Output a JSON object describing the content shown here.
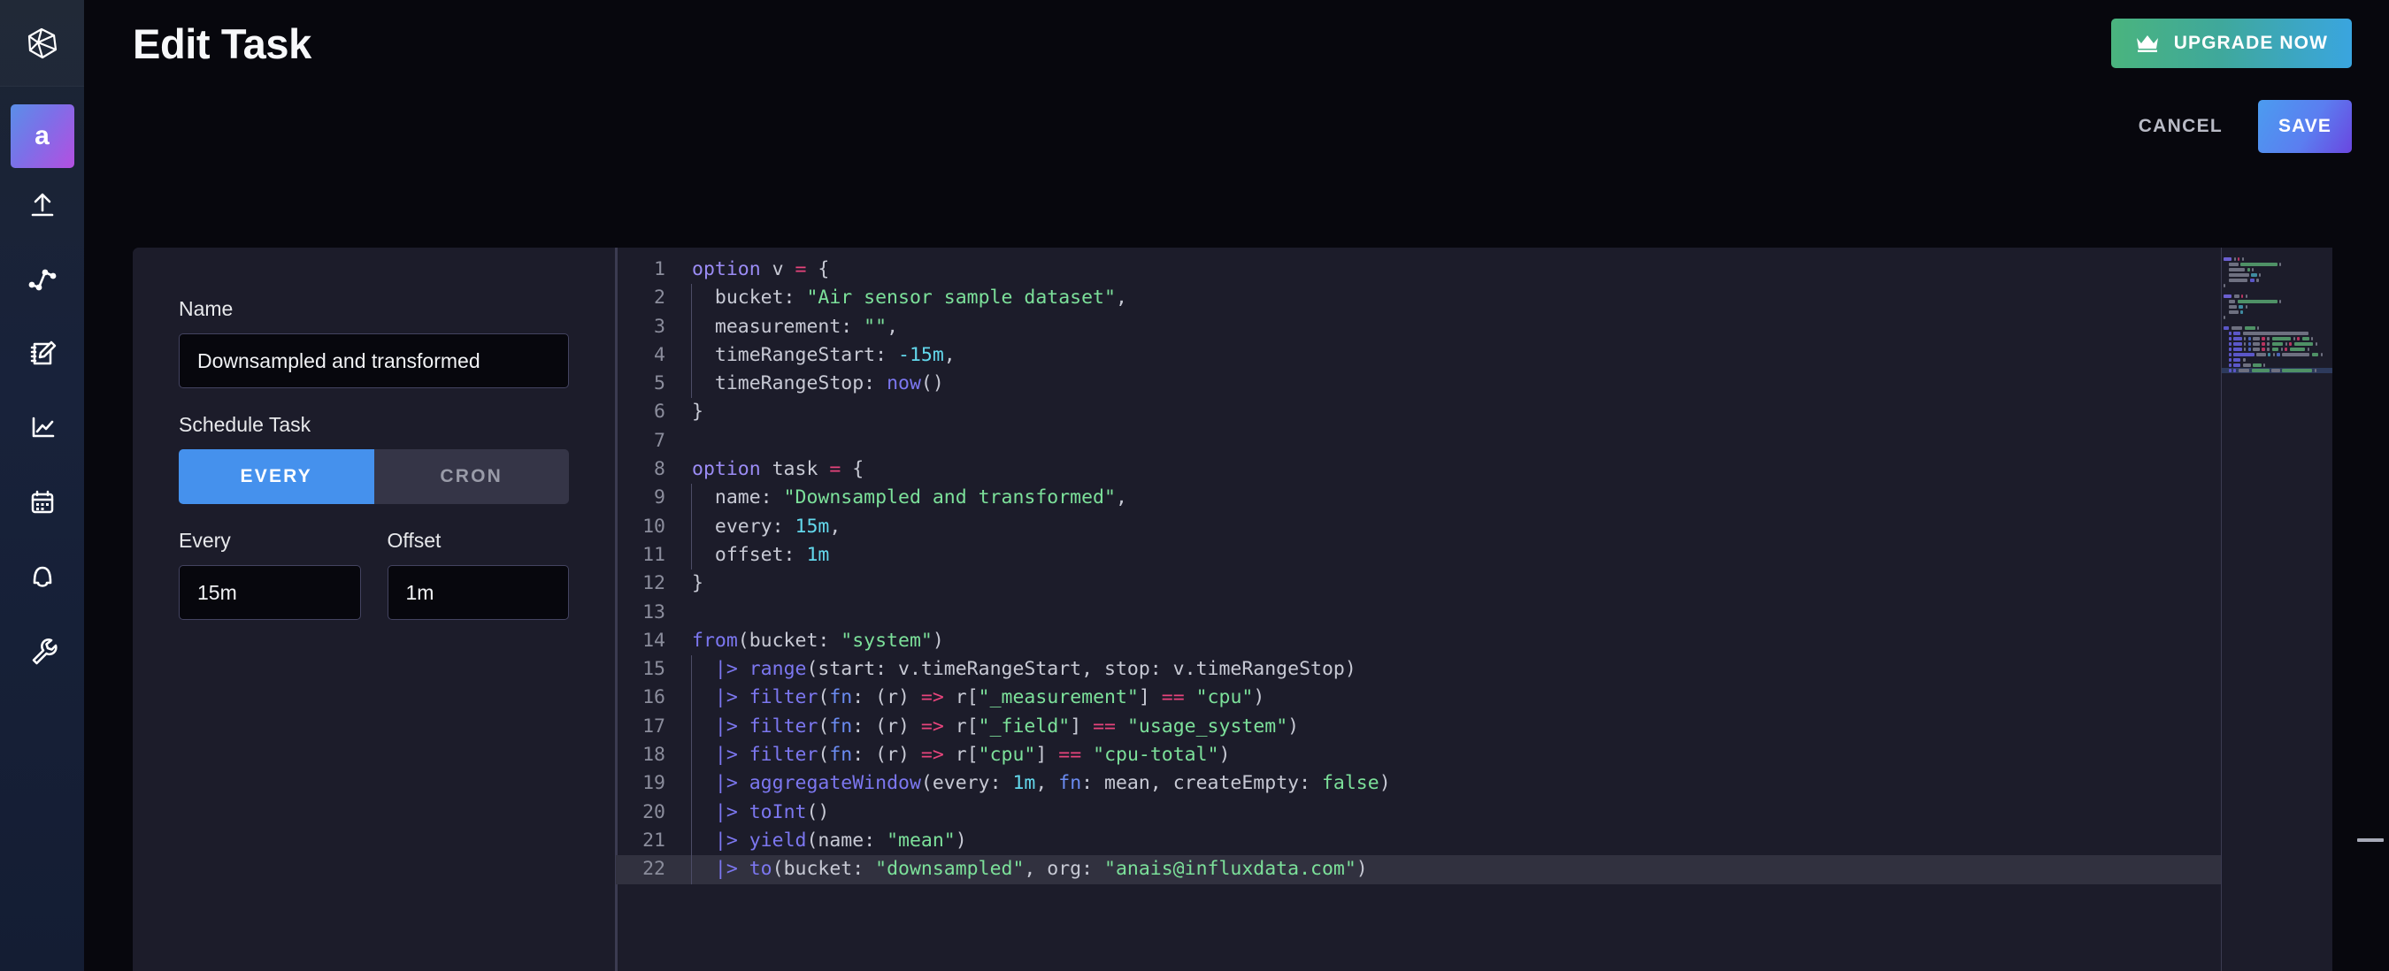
{
  "app": {
    "logo_icon": "influxdb-hexagon-logo",
    "background_color": "#07070d"
  },
  "sidebar": {
    "org_avatar": {
      "initial": "a",
      "gradient_from": "#5a8fe8",
      "gradient_to": "#b44fe0"
    },
    "items": [
      {
        "name": "load-data",
        "icon": "upload-arrow-icon"
      },
      {
        "name": "data-explorer",
        "icon": "line-graph-nodes-icon"
      },
      {
        "name": "notebooks",
        "icon": "notebook-pencil-icon"
      },
      {
        "name": "dashboards",
        "icon": "chart-axes-icon"
      },
      {
        "name": "tasks",
        "icon": "calendar-icon"
      },
      {
        "name": "alerts",
        "icon": "bell-icon"
      },
      {
        "name": "settings",
        "icon": "wrench-icon"
      }
    ]
  },
  "header": {
    "title": "Edit Task",
    "upgrade_label": "UPGRADE NOW",
    "upgrade_icon": "crown-icon",
    "upgrade_gradient_from": "#4ab47e",
    "upgrade_gradient_to": "#3aa5df"
  },
  "actions": {
    "cancel_label": "CANCEL",
    "save_label": "SAVE",
    "save_gradient_from": "#4b9cf0",
    "save_gradient_to": "#6a46e0"
  },
  "form": {
    "name_label": "Name",
    "name_value": "Downsampled and transformed",
    "schedule_label": "Schedule Task",
    "schedule_options": [
      "EVERY",
      "CRON"
    ],
    "schedule_selected": "EVERY",
    "active_toggle_color": "#4591ed",
    "inactive_toggle_color": "#353547",
    "every_label": "Every",
    "every_value": "15m",
    "offset_label": "Offset",
    "offset_value": "1m"
  },
  "editor": {
    "active_line": 22,
    "syntax_colors": {
      "keyword": "#9b8cf5",
      "operator": "#e8447c",
      "pipe": "#7c77f0",
      "function": "#7c77f0",
      "string": "#7ce09a",
      "number": "#63d8ec",
      "plain": "#c7c9d4"
    },
    "lines": [
      {
        "n": 1,
        "tokens": [
          {
            "t": "option ",
            "c": "kw"
          },
          {
            "t": "v ",
            "c": "plain"
          },
          {
            "t": "=",
            "c": "op"
          },
          {
            "t": " {",
            "c": "plain"
          }
        ]
      },
      {
        "n": 2,
        "indent": true,
        "tokens": [
          {
            "t": "  bucket: ",
            "c": "plain"
          },
          {
            "t": "\"Air sensor sample dataset\"",
            "c": "str"
          },
          {
            "t": ",",
            "c": "plain"
          }
        ]
      },
      {
        "n": 3,
        "indent": true,
        "tokens": [
          {
            "t": "  measurement: ",
            "c": "plain"
          },
          {
            "t": "\"\"",
            "c": "str"
          },
          {
            "t": ",",
            "c": "plain"
          }
        ]
      },
      {
        "n": 4,
        "indent": true,
        "tokens": [
          {
            "t": "  timeRangeStart: ",
            "c": "plain"
          },
          {
            "t": "-15m",
            "c": "num"
          },
          {
            "t": ",",
            "c": "plain"
          }
        ]
      },
      {
        "n": 5,
        "indent": true,
        "tokens": [
          {
            "t": "  timeRangeStop: ",
            "c": "plain"
          },
          {
            "t": "now",
            "c": "fn"
          },
          {
            "t": "()",
            "c": "plain"
          }
        ]
      },
      {
        "n": 6,
        "tokens": [
          {
            "t": "}",
            "c": "plain"
          }
        ]
      },
      {
        "n": 7,
        "tokens": []
      },
      {
        "n": 8,
        "tokens": [
          {
            "t": "option ",
            "c": "kw"
          },
          {
            "t": "task ",
            "c": "plain"
          },
          {
            "t": "=",
            "c": "op"
          },
          {
            "t": " {",
            "c": "plain"
          }
        ]
      },
      {
        "n": 9,
        "indent": true,
        "tokens": [
          {
            "t": "  name: ",
            "c": "plain"
          },
          {
            "t": "\"Downsampled and transformed\"",
            "c": "str"
          },
          {
            "t": ",",
            "c": "plain"
          }
        ]
      },
      {
        "n": 10,
        "indent": true,
        "tokens": [
          {
            "t": "  every: ",
            "c": "plain"
          },
          {
            "t": "15m",
            "c": "num"
          },
          {
            "t": ",",
            "c": "plain"
          }
        ]
      },
      {
        "n": 11,
        "indent": true,
        "tokens": [
          {
            "t": "  offset: ",
            "c": "plain"
          },
          {
            "t": "1m",
            "c": "num"
          }
        ]
      },
      {
        "n": 12,
        "tokens": [
          {
            "t": "}",
            "c": "plain"
          }
        ]
      },
      {
        "n": 13,
        "tokens": []
      },
      {
        "n": 14,
        "tokens": [
          {
            "t": "from",
            "c": "fn"
          },
          {
            "t": "(bucket: ",
            "c": "plain"
          },
          {
            "t": "\"system\"",
            "c": "str"
          },
          {
            "t": ")",
            "c": "plain"
          }
        ]
      },
      {
        "n": 15,
        "indent": true,
        "tokens": [
          {
            "t": "  |>",
            "c": "pipe"
          },
          {
            "t": " ",
            "c": "plain"
          },
          {
            "t": "range",
            "c": "fn"
          },
          {
            "t": "(start: v.timeRangeStart, stop: v.timeRangeStop)",
            "c": "plain"
          }
        ]
      },
      {
        "n": 16,
        "indent": true,
        "tokens": [
          {
            "t": "  |>",
            "c": "pipe"
          },
          {
            "t": " ",
            "c": "plain"
          },
          {
            "t": "filter",
            "c": "fn"
          },
          {
            "t": "(",
            "c": "plain"
          },
          {
            "t": "fn",
            "c": "kw2"
          },
          {
            "t": ": (r) ",
            "c": "plain"
          },
          {
            "t": "=>",
            "c": "op"
          },
          {
            "t": " r[",
            "c": "plain"
          },
          {
            "t": "\"_measurement\"",
            "c": "str"
          },
          {
            "t": "] ",
            "c": "plain"
          },
          {
            "t": "==",
            "c": "op"
          },
          {
            "t": " ",
            "c": "plain"
          },
          {
            "t": "\"cpu\"",
            "c": "str"
          },
          {
            "t": ")",
            "c": "plain"
          }
        ]
      },
      {
        "n": 17,
        "indent": true,
        "tokens": [
          {
            "t": "  |>",
            "c": "pipe"
          },
          {
            "t": " ",
            "c": "plain"
          },
          {
            "t": "filter",
            "c": "fn"
          },
          {
            "t": "(",
            "c": "plain"
          },
          {
            "t": "fn",
            "c": "kw2"
          },
          {
            "t": ": (r) ",
            "c": "plain"
          },
          {
            "t": "=>",
            "c": "op"
          },
          {
            "t": " r[",
            "c": "plain"
          },
          {
            "t": "\"_field\"",
            "c": "str"
          },
          {
            "t": "] ",
            "c": "plain"
          },
          {
            "t": "==",
            "c": "op"
          },
          {
            "t": " ",
            "c": "plain"
          },
          {
            "t": "\"usage_system\"",
            "c": "str"
          },
          {
            "t": ")",
            "c": "plain"
          }
        ]
      },
      {
        "n": 18,
        "indent": true,
        "tokens": [
          {
            "t": "  |>",
            "c": "pipe"
          },
          {
            "t": " ",
            "c": "plain"
          },
          {
            "t": "filter",
            "c": "fn"
          },
          {
            "t": "(",
            "c": "plain"
          },
          {
            "t": "fn",
            "c": "kw2"
          },
          {
            "t": ": (r) ",
            "c": "plain"
          },
          {
            "t": "=>",
            "c": "op"
          },
          {
            "t": " r[",
            "c": "plain"
          },
          {
            "t": "\"cpu\"",
            "c": "str"
          },
          {
            "t": "] ",
            "c": "plain"
          },
          {
            "t": "==",
            "c": "op"
          },
          {
            "t": " ",
            "c": "plain"
          },
          {
            "t": "\"cpu-total\"",
            "c": "str"
          },
          {
            "t": ")",
            "c": "plain"
          }
        ]
      },
      {
        "n": 19,
        "indent": true,
        "tokens": [
          {
            "t": "  |>",
            "c": "pipe"
          },
          {
            "t": " ",
            "c": "plain"
          },
          {
            "t": "aggregateWindow",
            "c": "fn"
          },
          {
            "t": "(every: ",
            "c": "plain"
          },
          {
            "t": "1m",
            "c": "num"
          },
          {
            "t": ", ",
            "c": "plain"
          },
          {
            "t": "fn",
            "c": "kw2"
          },
          {
            "t": ": mean, createEmpty: ",
            "c": "plain"
          },
          {
            "t": "false",
            "c": "str"
          },
          {
            "t": ")",
            "c": "plain"
          }
        ]
      },
      {
        "n": 20,
        "indent": true,
        "tokens": [
          {
            "t": "  |>",
            "c": "pipe"
          },
          {
            "t": " ",
            "c": "plain"
          },
          {
            "t": "toInt",
            "c": "fn"
          },
          {
            "t": "()",
            "c": "plain"
          }
        ]
      },
      {
        "n": 21,
        "indent": true,
        "tokens": [
          {
            "t": "  |>",
            "c": "pipe"
          },
          {
            "t": " ",
            "c": "plain"
          },
          {
            "t": "yield",
            "c": "fn"
          },
          {
            "t": "(name: ",
            "c": "plain"
          },
          {
            "t": "\"mean\"",
            "c": "str"
          },
          {
            "t": ")",
            "c": "plain"
          }
        ]
      },
      {
        "n": 22,
        "indent": true,
        "active": true,
        "tokens": [
          {
            "t": "  |>",
            "c": "pipe"
          },
          {
            "t": " ",
            "c": "plain"
          },
          {
            "t": "to",
            "c": "fn"
          },
          {
            "t": "(bucket: ",
            "c": "plain"
          },
          {
            "t": "\"downsampled\"",
            "c": "str"
          },
          {
            "t": ", org: ",
            "c": "plain"
          },
          {
            "t": "\"anais@influxdata.com\"",
            "c": "str"
          },
          {
            "t": ")",
            "c": "plain"
          }
        ]
      }
    ]
  },
  "minimap": {
    "name": "code-minimap",
    "active_line": 22
  }
}
